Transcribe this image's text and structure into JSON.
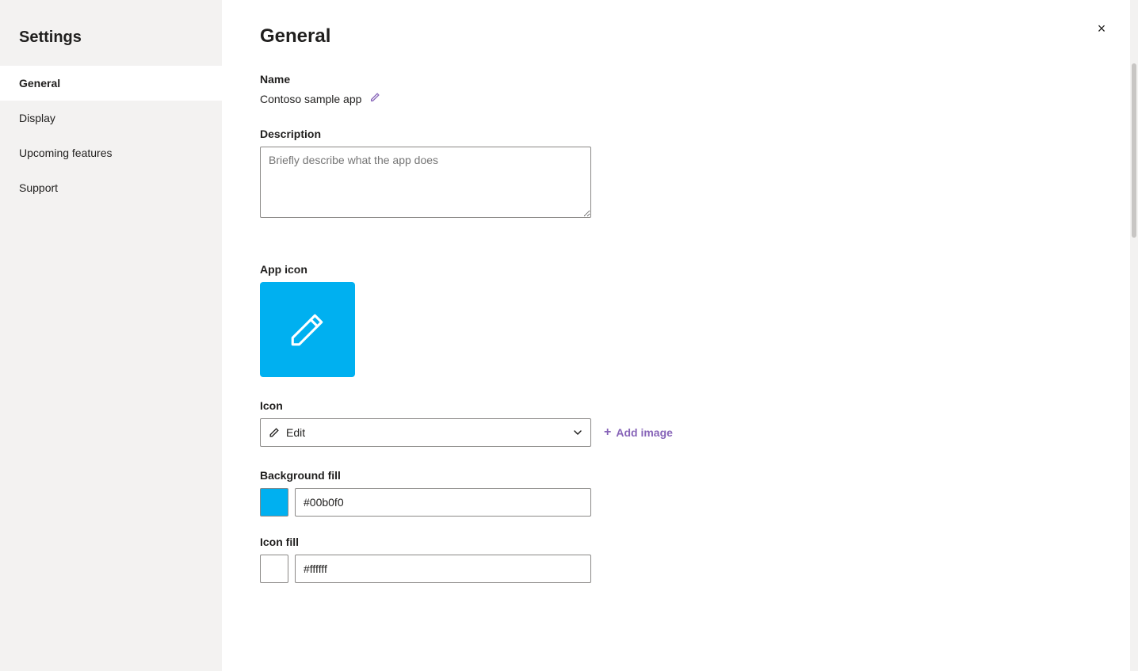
{
  "sidebar": {
    "title": "Settings",
    "items": [
      {
        "label": "General",
        "active": true
      },
      {
        "label": "Display",
        "active": false
      },
      {
        "label": "Upcoming features",
        "active": false
      },
      {
        "label": "Support",
        "active": false
      }
    ]
  },
  "main": {
    "page_title": "General",
    "close_button_label": "×",
    "sections": {
      "name": {
        "label": "Name",
        "value": "Contoso sample app",
        "edit_icon": "✏"
      },
      "description": {
        "label": "Description",
        "placeholder": "Briefly describe what the app does"
      },
      "app_icon": {
        "label": "App icon",
        "icon_bg_color": "#00b0f0"
      },
      "icon": {
        "label": "Icon",
        "select_value": "Edit",
        "add_image_label": "Add image",
        "plus_symbol": "+"
      },
      "background_fill": {
        "label": "Background fill",
        "color": "#00b0f0",
        "color_hex": "#00b0f0"
      },
      "icon_fill": {
        "label": "Icon fill",
        "color": "#ffffff",
        "color_hex": "#ffffff"
      }
    }
  }
}
